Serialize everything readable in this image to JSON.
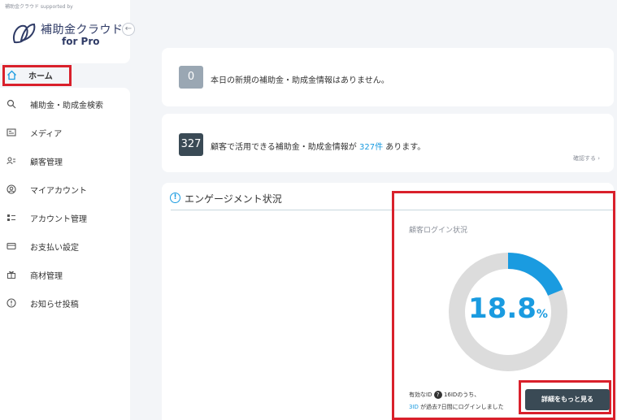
{
  "brand": {
    "supported_by": "補助金クラウド supported by",
    "title": "補助金クラウド",
    "subtitle": "for Pro",
    "primary_color": "#2f3b66"
  },
  "sidebar": {
    "home_label": "ホーム",
    "items": [
      {
        "label": "補助金・助成金検索",
        "icon": "search-icon"
      },
      {
        "label": "メディア",
        "icon": "newspaper-icon"
      },
      {
        "label": "顧客管理",
        "icon": "users-icon"
      },
      {
        "label": "マイアカウント",
        "icon": "user-circle-icon"
      },
      {
        "label": "アカウント管理",
        "icon": "list-icon"
      },
      {
        "label": "お支払い設定",
        "icon": "credit-card-icon"
      },
      {
        "label": "商材管理",
        "icon": "gift-icon"
      },
      {
        "label": "お知らせ投稿",
        "icon": "alert-circle-icon"
      }
    ]
  },
  "new_info": {
    "count": "0",
    "message": "本日の新規の補助金・助成金情報はありません。"
  },
  "usable": {
    "count": "327",
    "prefix": "顧客で活用できる補助金・助成金情報が",
    "count_link": "327件",
    "suffix": "あります。",
    "more_link": "確認する ›"
  },
  "engagement": {
    "title": "エンゲージメント状況",
    "login_title": "顧客ログイン状況",
    "percent_value": "18.8",
    "percent_unit": "%",
    "progress_fraction": 0.188,
    "stat_line1_pre": "有効なID",
    "stat_line1_help": "?",
    "stat_line1_post": "16IDのうち、",
    "stat_line2_link": "3ID",
    "stat_line2_post": "が過去7日間にログインしました",
    "detail_button": "詳細をもっと見る",
    "accent_color": "#1a9be0",
    "track_color": "#dcdcdc"
  },
  "highlight_color": "#d9202b"
}
